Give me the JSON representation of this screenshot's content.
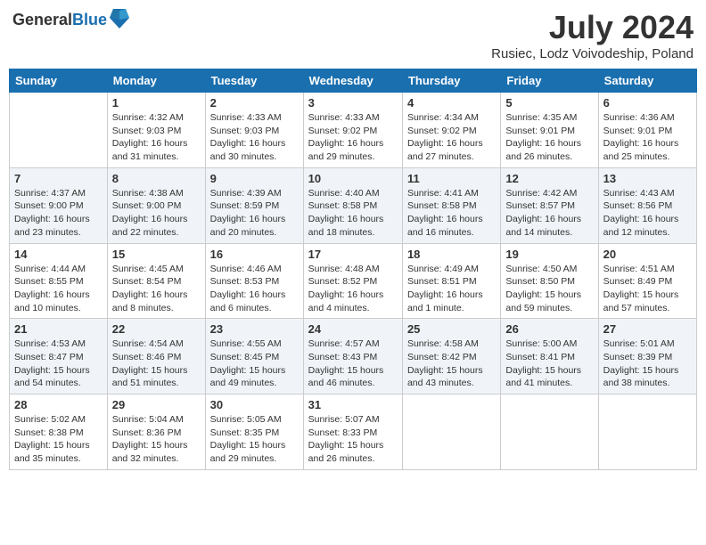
{
  "header": {
    "logo_general": "General",
    "logo_blue": "Blue",
    "month_year": "July 2024",
    "location": "Rusiec, Lodz Voivodeship, Poland"
  },
  "weekdays": [
    "Sunday",
    "Monday",
    "Tuesday",
    "Wednesday",
    "Thursday",
    "Friday",
    "Saturday"
  ],
  "weeks": [
    [
      {
        "day": "",
        "sunrise": "",
        "sunset": "",
        "daylight": ""
      },
      {
        "day": "1",
        "sunrise": "Sunrise: 4:32 AM",
        "sunset": "Sunset: 9:03 PM",
        "daylight": "Daylight: 16 hours and 31 minutes."
      },
      {
        "day": "2",
        "sunrise": "Sunrise: 4:33 AM",
        "sunset": "Sunset: 9:03 PM",
        "daylight": "Daylight: 16 hours and 30 minutes."
      },
      {
        "day": "3",
        "sunrise": "Sunrise: 4:33 AM",
        "sunset": "Sunset: 9:02 PM",
        "daylight": "Daylight: 16 hours and 29 minutes."
      },
      {
        "day": "4",
        "sunrise": "Sunrise: 4:34 AM",
        "sunset": "Sunset: 9:02 PM",
        "daylight": "Daylight: 16 hours and 27 minutes."
      },
      {
        "day": "5",
        "sunrise": "Sunrise: 4:35 AM",
        "sunset": "Sunset: 9:01 PM",
        "daylight": "Daylight: 16 hours and 26 minutes."
      },
      {
        "day": "6",
        "sunrise": "Sunrise: 4:36 AM",
        "sunset": "Sunset: 9:01 PM",
        "daylight": "Daylight: 16 hours and 25 minutes."
      }
    ],
    [
      {
        "day": "7",
        "sunrise": "Sunrise: 4:37 AM",
        "sunset": "Sunset: 9:00 PM",
        "daylight": "Daylight: 16 hours and 23 minutes."
      },
      {
        "day": "8",
        "sunrise": "Sunrise: 4:38 AM",
        "sunset": "Sunset: 9:00 PM",
        "daylight": "Daylight: 16 hours and 22 minutes."
      },
      {
        "day": "9",
        "sunrise": "Sunrise: 4:39 AM",
        "sunset": "Sunset: 8:59 PM",
        "daylight": "Daylight: 16 hours and 20 minutes."
      },
      {
        "day": "10",
        "sunrise": "Sunrise: 4:40 AM",
        "sunset": "Sunset: 8:58 PM",
        "daylight": "Daylight: 16 hours and 18 minutes."
      },
      {
        "day": "11",
        "sunrise": "Sunrise: 4:41 AM",
        "sunset": "Sunset: 8:58 PM",
        "daylight": "Daylight: 16 hours and 16 minutes."
      },
      {
        "day": "12",
        "sunrise": "Sunrise: 4:42 AM",
        "sunset": "Sunset: 8:57 PM",
        "daylight": "Daylight: 16 hours and 14 minutes."
      },
      {
        "day": "13",
        "sunrise": "Sunrise: 4:43 AM",
        "sunset": "Sunset: 8:56 PM",
        "daylight": "Daylight: 16 hours and 12 minutes."
      }
    ],
    [
      {
        "day": "14",
        "sunrise": "Sunrise: 4:44 AM",
        "sunset": "Sunset: 8:55 PM",
        "daylight": "Daylight: 16 hours and 10 minutes."
      },
      {
        "day": "15",
        "sunrise": "Sunrise: 4:45 AM",
        "sunset": "Sunset: 8:54 PM",
        "daylight": "Daylight: 16 hours and 8 minutes."
      },
      {
        "day": "16",
        "sunrise": "Sunrise: 4:46 AM",
        "sunset": "Sunset: 8:53 PM",
        "daylight": "Daylight: 16 hours and 6 minutes."
      },
      {
        "day": "17",
        "sunrise": "Sunrise: 4:48 AM",
        "sunset": "Sunset: 8:52 PM",
        "daylight": "Daylight: 16 hours and 4 minutes."
      },
      {
        "day": "18",
        "sunrise": "Sunrise: 4:49 AM",
        "sunset": "Sunset: 8:51 PM",
        "daylight": "Daylight: 16 hours and 1 minute."
      },
      {
        "day": "19",
        "sunrise": "Sunrise: 4:50 AM",
        "sunset": "Sunset: 8:50 PM",
        "daylight": "Daylight: 15 hours and 59 minutes."
      },
      {
        "day": "20",
        "sunrise": "Sunrise: 4:51 AM",
        "sunset": "Sunset: 8:49 PM",
        "daylight": "Daylight: 15 hours and 57 minutes."
      }
    ],
    [
      {
        "day": "21",
        "sunrise": "Sunrise: 4:53 AM",
        "sunset": "Sunset: 8:47 PM",
        "daylight": "Daylight: 15 hours and 54 minutes."
      },
      {
        "day": "22",
        "sunrise": "Sunrise: 4:54 AM",
        "sunset": "Sunset: 8:46 PM",
        "daylight": "Daylight: 15 hours and 51 minutes."
      },
      {
        "day": "23",
        "sunrise": "Sunrise: 4:55 AM",
        "sunset": "Sunset: 8:45 PM",
        "daylight": "Daylight: 15 hours and 49 minutes."
      },
      {
        "day": "24",
        "sunrise": "Sunrise: 4:57 AM",
        "sunset": "Sunset: 8:43 PM",
        "daylight": "Daylight: 15 hours and 46 minutes."
      },
      {
        "day": "25",
        "sunrise": "Sunrise: 4:58 AM",
        "sunset": "Sunset: 8:42 PM",
        "daylight": "Daylight: 15 hours and 43 minutes."
      },
      {
        "day": "26",
        "sunrise": "Sunrise: 5:00 AM",
        "sunset": "Sunset: 8:41 PM",
        "daylight": "Daylight: 15 hours and 41 minutes."
      },
      {
        "day": "27",
        "sunrise": "Sunrise: 5:01 AM",
        "sunset": "Sunset: 8:39 PM",
        "daylight": "Daylight: 15 hours and 38 minutes."
      }
    ],
    [
      {
        "day": "28",
        "sunrise": "Sunrise: 5:02 AM",
        "sunset": "Sunset: 8:38 PM",
        "daylight": "Daylight: 15 hours and 35 minutes."
      },
      {
        "day": "29",
        "sunrise": "Sunrise: 5:04 AM",
        "sunset": "Sunset: 8:36 PM",
        "daylight": "Daylight: 15 hours and 32 minutes."
      },
      {
        "day": "30",
        "sunrise": "Sunrise: 5:05 AM",
        "sunset": "Sunset: 8:35 PM",
        "daylight": "Daylight: 15 hours and 29 minutes."
      },
      {
        "day": "31",
        "sunrise": "Sunrise: 5:07 AM",
        "sunset": "Sunset: 8:33 PM",
        "daylight": "Daylight: 15 hours and 26 minutes."
      },
      {
        "day": "",
        "sunrise": "",
        "sunset": "",
        "daylight": ""
      },
      {
        "day": "",
        "sunrise": "",
        "sunset": "",
        "daylight": ""
      },
      {
        "day": "",
        "sunrise": "",
        "sunset": "",
        "daylight": ""
      }
    ]
  ]
}
